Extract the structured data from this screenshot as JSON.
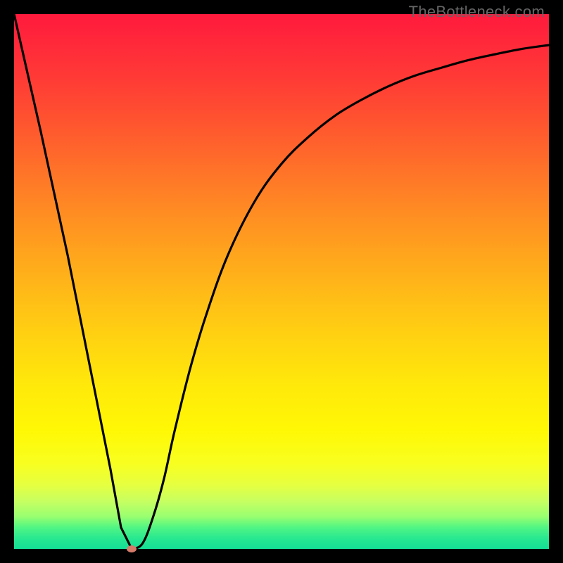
{
  "watermark": "TheBottleneck.com",
  "chart_data": {
    "type": "line",
    "title": "",
    "xlabel": "",
    "ylabel": "",
    "xlim": [
      0,
      100
    ],
    "ylim": [
      0,
      100
    ],
    "grid": false,
    "series": [
      {
        "name": "curve",
        "x": [
          0,
          5,
          10,
          14,
          18,
          20,
          22,
          24,
          26,
          28,
          30,
          33,
          36,
          40,
          45,
          50,
          55,
          60,
          65,
          70,
          75,
          80,
          85,
          90,
          95,
          100
        ],
        "values": [
          100,
          78,
          55,
          35,
          15,
          4,
          0,
          1,
          6,
          13,
          22,
          34,
          44,
          55,
          65,
          72,
          77,
          81,
          84,
          86.5,
          88.5,
          90,
          91.4,
          92.5,
          93.5,
          94.2
        ]
      }
    ],
    "marker": {
      "x": 22,
      "y": 0,
      "color": "#d67a6a"
    },
    "background_gradient": {
      "top": "#ff1a3c",
      "mid": "#ffd610",
      "bottom": "#14de96"
    }
  }
}
